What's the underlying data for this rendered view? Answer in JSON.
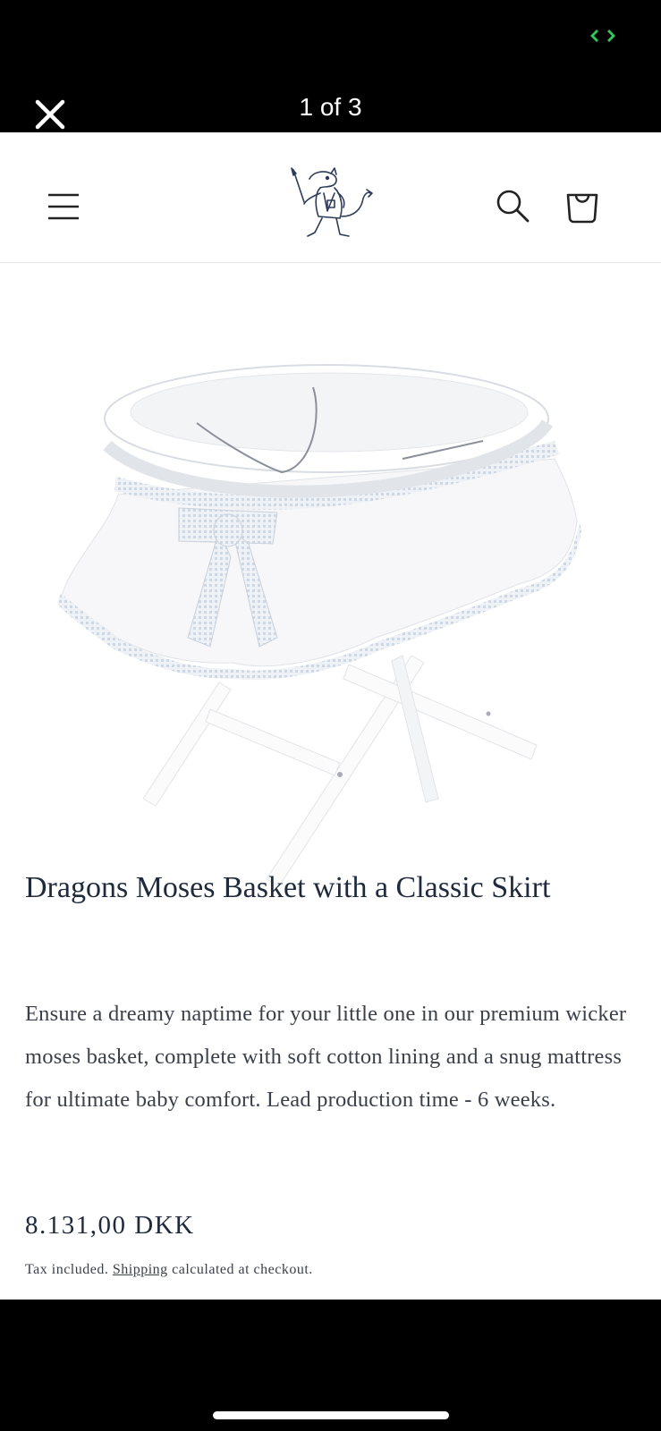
{
  "viewer": {
    "counter": "1 of 3",
    "colors": {
      "background": "#000000",
      "text": "#ffffff",
      "status_icon": "#34c759"
    }
  },
  "icons": {
    "close": "close-icon",
    "status": "screen-rotation-icon",
    "menu": "hamburger-menu-icon",
    "logo": "dragon-logo",
    "search": "search-icon",
    "cart": "shopping-bag-icon"
  },
  "product": {
    "image": "white-moses-basket-on-stand",
    "title": "Dragons Moses Basket with a Classic Skirt",
    "description": "Ensure a dreamy naptime for your little one in our premium wicker moses basket, complete with soft cotton lining and a snug mattress for ultimate baby comfort. Lead production time - 6 weeks.",
    "price": "8.131,00 DKK",
    "tax_note_before": "Tax included. ",
    "shipping_link": "Shipping",
    "tax_note_after": " calculated at checkout."
  },
  "colors": {
    "text_primary": "#1f2a3d",
    "text_secondary": "#3a3f4a",
    "page_bg": "#ffffff"
  }
}
